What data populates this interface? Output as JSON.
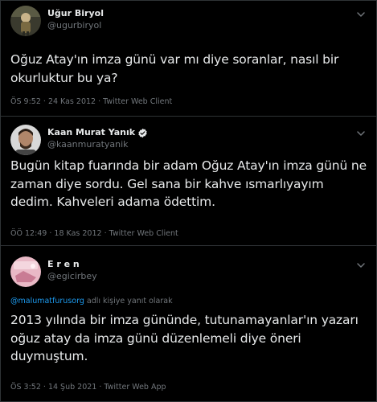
{
  "tweets": [
    {
      "display_name": "Uğur Biryol",
      "handle": "@ugurbiryol",
      "verified": false,
      "text": "Oğuz Atay'ın imza günü var mı diye soranlar, nasıl bir okurluktur bu ya?",
      "time": "ÖS 9:52",
      "date": "24 Kas 2012",
      "client": "Twitter Web Client",
      "avatar_icon": "portrait-avatar-icon"
    },
    {
      "display_name": "Kaan Murat Yanık",
      "handle": "@kaanmuratyanik",
      "verified": true,
      "text": "Bugün kitap fuarında bir adam Oğuz Atay'ın imza günü ne zaman diye sordu. Gel sana bir kahve ısmarlıyayım dedim. Kahveleri adama ödettim.",
      "time": "ÖÖ 12:49",
      "date": "18 Kas 2012",
      "client": "Twitter Web Client",
      "avatar_icon": "portrait-avatar-icon"
    },
    {
      "display_name": "E r e n",
      "handle": "@egicirbey",
      "verified": false,
      "reply_mention": "@malumatfurusorg",
      "reply_suffix": " adlı kişiye yanıt olarak",
      "text": "2013 yılında bir imza gününde, tutunamayanlar'ın yazarı oğuz atay da imza günü düzenlemeli diye öneri duymuştum.",
      "time": "ÖS 3:52",
      "date": "14 Şub 2021",
      "client": "Twitter Web App",
      "avatar_icon": "pink-image-avatar-icon"
    }
  ],
  "meta_separator": " · ",
  "colors": {
    "background": "#000000",
    "text": "#e7e9ea",
    "secondary": "#71767b",
    "accent": "#1d9bf0",
    "divider": "#2f3336"
  }
}
